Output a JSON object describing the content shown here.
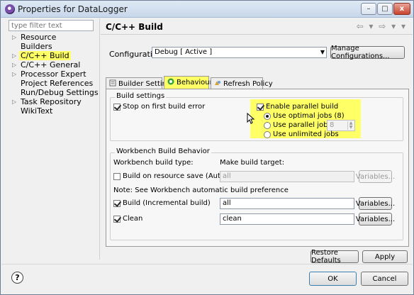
{
  "window": {
    "title": "Properties for DataLogger",
    "controls": [
      "–",
      "□",
      "x"
    ]
  },
  "sidebar": {
    "filter_placeholder": "type filter text",
    "items": [
      {
        "label": "Resource",
        "arrow": "▷"
      },
      {
        "label": "Builders",
        "arrow": ""
      },
      {
        "label": "C/C++ Build",
        "arrow": "▷",
        "selected": true
      },
      {
        "label": "C/C++ General",
        "arrow": "▷"
      },
      {
        "label": "Processor Expert",
        "arrow": "▷"
      },
      {
        "label": "Project References",
        "arrow": ""
      },
      {
        "label": "Run/Debug Settings",
        "arrow": ""
      },
      {
        "label": "Task Repository",
        "arrow": "▷"
      },
      {
        "label": "WikiText",
        "arrow": ""
      }
    ]
  },
  "header": {
    "title": "C/C++ Build",
    "nav_icons": "⇦ ▾ ⇨ ▾ ▾"
  },
  "configuration": {
    "label": "Configuration:",
    "value": "Debug  [ Active ]",
    "manage_button": "Manage Configurations..."
  },
  "tabs": [
    {
      "label": "Builder Settings",
      "active": false
    },
    {
      "label": "Behaviour",
      "active": true
    },
    {
      "label": "Refresh Policy",
      "active": false
    }
  ],
  "build_settings": {
    "title": "Build settings",
    "stop_on_first_error": {
      "label": "Stop on first build error",
      "checked": true
    },
    "enable_parallel": {
      "label": "Enable parallel build",
      "checked": true
    },
    "use_optimal": {
      "label": "Use optimal jobs (8)",
      "selected": true
    },
    "use_parallel": {
      "label": "Use parallel jobs:",
      "selected": false,
      "value": "8"
    },
    "use_unlimited": {
      "label": "Use unlimited jobs",
      "selected": false
    }
  },
  "workbench": {
    "title": "Workbench Build Behavior",
    "build_type_label": "Workbench build type:",
    "make_target_label": "Make build target:",
    "auto_build": {
      "label": "Build on resource save (Auto build)",
      "checked": false,
      "target": "all",
      "variables": "Variables..."
    },
    "note": "Note: See Workbench automatic build preference",
    "incremental": {
      "label": "Build (Incremental build)",
      "checked": true,
      "target": "all",
      "variables": "Variables..."
    },
    "clean": {
      "label": "Clean",
      "checked": true,
      "target": "clean",
      "variables": "Variables..."
    }
  },
  "buttons": {
    "restore_defaults": "Restore Defaults",
    "apply": "Apply",
    "ok": "OK",
    "cancel": "Cancel",
    "help": "?"
  },
  "colors": {
    "highlight": "#ffff66",
    "active_tab_icon": "#3aa33a"
  }
}
